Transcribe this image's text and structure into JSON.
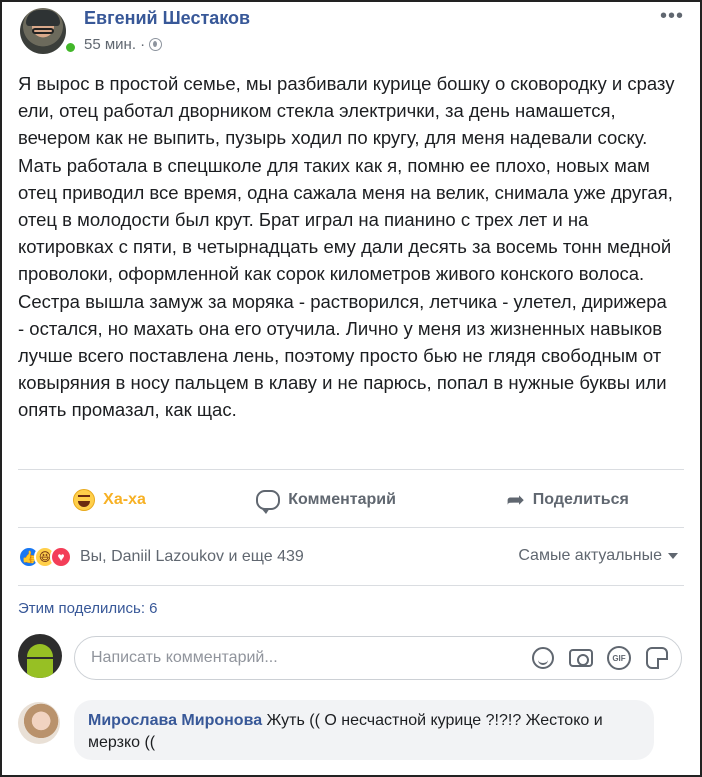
{
  "post": {
    "author": "Евгений Шестаков",
    "time": "55 мин. ·",
    "text": "Я вырос в простой семье, мы разбивали курице бошку о сковородку и сразу ели, отец работал дворником стекла электрички, за день намашется, вечером как не выпить, пузырь ходил по кругу, для меня надевали соску. Мать работала в спецшколе для таких как я, помню ее плохо, новых мам отец приводил все время, одна сажала меня на велик, снимала уже другая, отец в молодости был крут. Брат играл на пианино с трех лет и на котировках с пяти, в четырнадцать ему дали десять за восемь тонн медной проволоки, оформленной как сорок километров живого конского волоса. Сестра вышла замуж за моряка - растворился, летчика - улетел, дирижера - остался, но махать она его отучила. Лично у меня из жизненных навыков лучше всего поставлена лень, поэтому просто бью не глядя свободным от ковыряния в носу пальцем в клаву и не парюсь, попал в нужные буквы или опять промазал, как щас."
  },
  "actions": {
    "haha": "Ха-ха",
    "comment": "Комментарий",
    "share": "Поделиться"
  },
  "reactions": {
    "summary": "Вы, Daniil Lazoukov и еще 439",
    "sort": "Самые актуальные"
  },
  "shared_count": "Этим поделились: 6",
  "comment_input": {
    "placeholder": "Написать комментарий..."
  },
  "comments": [
    {
      "author": "Мирослава Миронова",
      "text": " Жуть (( О несчастной курице ?!?!? Жестоко и мерзко (("
    }
  ],
  "colors": {
    "link": "#385898",
    "haha": "#f7b125",
    "online": "#42b72a"
  }
}
